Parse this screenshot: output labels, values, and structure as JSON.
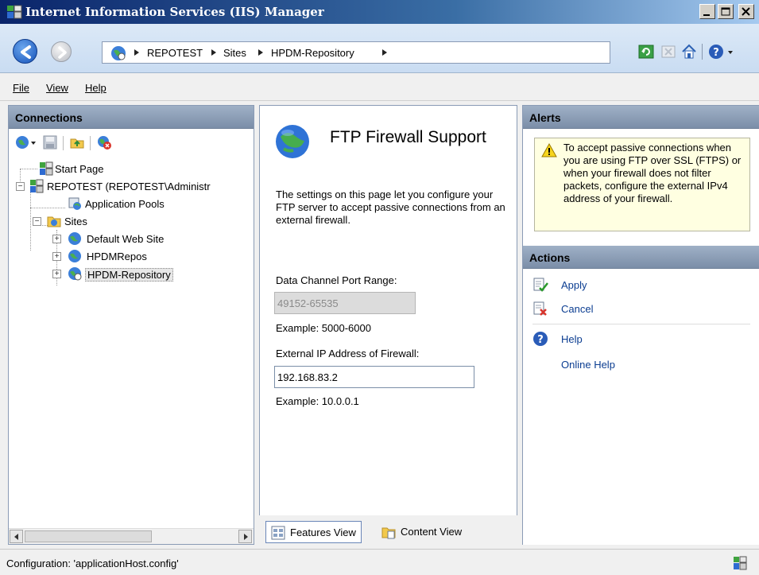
{
  "window": {
    "title": "Internet Information Services (IIS) Manager"
  },
  "address_bar": {
    "crumbs": [
      "REPOTEST",
      "Sites",
      "HPDM-Repository"
    ]
  },
  "menu": {
    "items": [
      "File",
      "View",
      "Help"
    ]
  },
  "connections": {
    "header": "Connections",
    "tree": {
      "start_page": "Start Page",
      "server": "REPOTEST (REPOTEST\\Administr",
      "app_pools": "Application Pools",
      "sites": "Sites",
      "site_items": [
        "Default Web Site",
        "HPDMRepos",
        "HPDM-Repository"
      ]
    }
  },
  "feature": {
    "title": "FTP Firewall Support",
    "description": "The settings on this page let you configure your FTP server to accept passive connections from an external firewall.",
    "port_range_label": "Data Channel Port Range:",
    "port_range_value": "49152-65535",
    "port_example": "Example: 5000-6000",
    "external_ip_label": "External IP Address of Firewall:",
    "external_ip_value": "192.168.83.2",
    "ip_example": "Example: 10.0.0.1"
  },
  "view_tabs": {
    "features": "Features View",
    "content": "Content View"
  },
  "alerts": {
    "header": "Alerts",
    "message": "To accept passive connections when you are using FTP over SSL (FTPS) or when your firewall does not filter packets, configure the external IPv4 address of your firewall."
  },
  "actions": {
    "header": "Actions",
    "apply": "Apply",
    "cancel": "Cancel",
    "help": "Help",
    "online_help": "Online Help"
  },
  "status": {
    "text": "Configuration: 'applicationHost.config'"
  },
  "colors": {
    "title_bar": "#0a246a",
    "panel_header": "#8a9cb4",
    "alert_bg": "#ffffe1",
    "link": "#0b3d91"
  }
}
